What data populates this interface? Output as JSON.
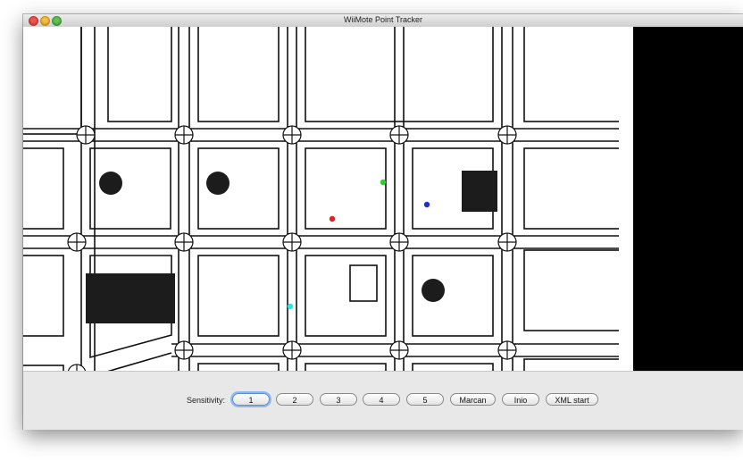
{
  "window": {
    "title": "WiiMote Point Tracker"
  },
  "controls": {
    "sensitivity_label": "Sensitivity:",
    "buttons": [
      "1",
      "2",
      "3",
      "4",
      "5",
      "Marcan",
      "Inio",
      "XML start"
    ],
    "focused_button": "1"
  },
  "tracked_points": [
    {
      "color": "#e8201e"
    },
    {
      "color": "#29d12e"
    },
    {
      "color": "#1f2fd0"
    },
    {
      "color": "#2ce6e8"
    }
  ],
  "colors": {
    "map_background": "#ffffff",
    "map_lines": "#111111",
    "side_panel": "#000000"
  }
}
